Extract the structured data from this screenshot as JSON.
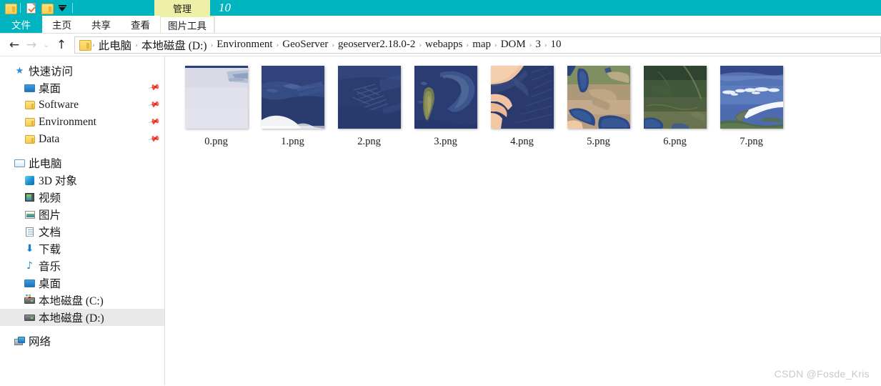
{
  "titlebar": {
    "window_title": "10",
    "contextual_tab_header": "管理",
    "quick_access": [
      {
        "name": "folder-icon",
        "label": "属性"
      },
      {
        "name": "properties-icon",
        "label": "新建文件夹"
      },
      {
        "name": "new-folder-icon",
        "label": "自定义快速访问工具栏"
      },
      {
        "name": "dropdown-icon",
        "label": "自定义"
      }
    ],
    "accent_color": "#00b4c0",
    "contextual_color": "#eef0a8"
  },
  "ribbon": {
    "tabs": [
      {
        "label": "文件",
        "active": true
      },
      {
        "label": "主页",
        "active": false
      },
      {
        "label": "共享",
        "active": false
      },
      {
        "label": "查看",
        "active": false
      }
    ],
    "contextual_tab": {
      "label": "图片工具"
    }
  },
  "addressbar": {
    "back_label": "←",
    "forward_label": "→",
    "recent_label": "⌄",
    "up_label": "↑",
    "breadcrumbs": [
      "此电脑",
      "本地磁盘 (D:)",
      "Environment",
      "GeoServer",
      "geoserver2.18.0-2",
      "webapps",
      "map",
      "DOM",
      "3",
      "10"
    ],
    "separator": "›"
  },
  "sidebar": {
    "groups": [
      {
        "name": "quick-access",
        "header": {
          "label": "快速访问",
          "icon": "star-pin-icon"
        },
        "items": [
          {
            "label": "桌面",
            "icon": "monitor-icon",
            "pinned": true
          },
          {
            "label": "Software",
            "icon": "folder-icon",
            "pinned": true
          },
          {
            "label": "Environment",
            "icon": "folder-icon",
            "pinned": true
          },
          {
            "label": "Data",
            "icon": "folder-icon",
            "pinned": true
          }
        ]
      },
      {
        "name": "this-pc",
        "header": {
          "label": "此电脑",
          "icon": "computer-icon"
        },
        "items": [
          {
            "label": "3D 对象",
            "icon": "cube-icon",
            "pinned": false
          },
          {
            "label": "视频",
            "icon": "video-icon",
            "pinned": false
          },
          {
            "label": "图片",
            "icon": "picture-icon",
            "pinned": false
          },
          {
            "label": "文档",
            "icon": "document-icon",
            "pinned": false
          },
          {
            "label": "下载",
            "icon": "download-icon",
            "pinned": false
          },
          {
            "label": "音乐",
            "icon": "music-icon",
            "pinned": false
          },
          {
            "label": "桌面",
            "icon": "monitor-icon",
            "pinned": false
          },
          {
            "label": "本地磁盘 (C:)",
            "icon": "system-drive-icon",
            "pinned": false
          },
          {
            "label": "本地磁盘 (D:)",
            "icon": "drive-icon",
            "pinned": false,
            "selected": true
          }
        ]
      },
      {
        "name": "network",
        "header": {
          "label": "网络",
          "icon": "network-icon"
        },
        "items": []
      }
    ],
    "selected_highlight": "#e9e9e9"
  },
  "files": [
    {
      "name": "0.png",
      "thumb": "ice-sheet-pale"
    },
    {
      "name": "1.png",
      "thumb": "ocean-antarctic-coast"
    },
    {
      "name": "2.png",
      "thumb": "ocean-ridges"
    },
    {
      "name": "3.png",
      "thumb": "madagascar-ocean"
    },
    {
      "name": "4.png",
      "thumb": "horn-of-africa"
    },
    {
      "name": "5.png",
      "thumb": "persian-gulf-caspian"
    },
    {
      "name": "6.png",
      "thumb": "green-landmass"
    },
    {
      "name": "7.png",
      "thumb": "ice-coastline"
    }
  ],
  "watermark": "CSDN @Fosde_Kris"
}
